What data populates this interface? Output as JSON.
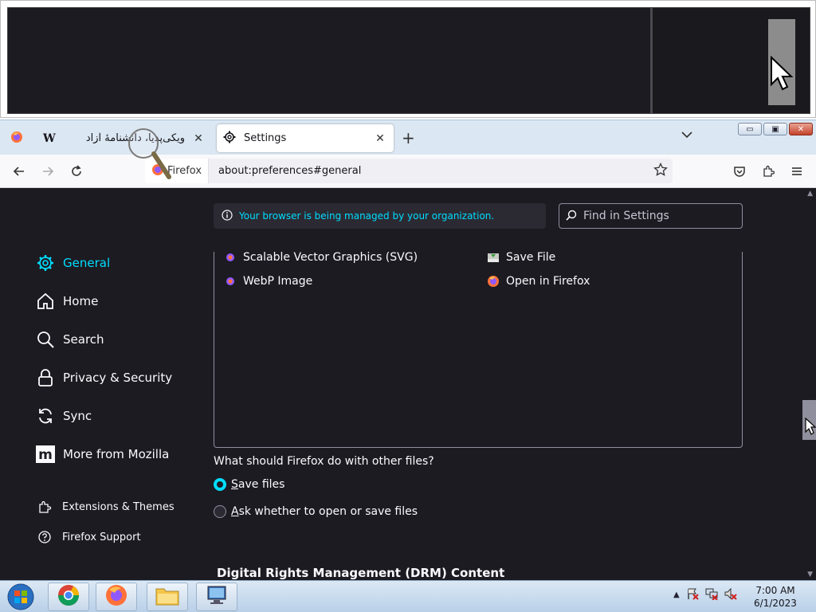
{
  "tabs": [
    {
      "label": "ویکی‌پدیا، دانشنامهٔ آزاد",
      "icon": "wikipedia-icon"
    },
    {
      "label": "Settings",
      "icon": "gear-icon",
      "active": true
    }
  ],
  "tabstrip": {
    "new_tab": "+",
    "list_all": "⌄"
  },
  "window_controls": {
    "minimize": "▭",
    "maximize": "▣",
    "close": "✕"
  },
  "navbar": {
    "identity_label": "Firefox",
    "url": "about:preferences#general"
  },
  "banner": {
    "message": "Your browser is being managed by your organization."
  },
  "search": {
    "placeholder": "Find in Settings"
  },
  "sidebar": {
    "items": [
      {
        "label": "General",
        "icon": "gear-icon",
        "active": true
      },
      {
        "label": "Home",
        "icon": "home-icon"
      },
      {
        "label": "Search",
        "icon": "search-icon"
      },
      {
        "label": "Privacy & Security",
        "icon": "lock-icon"
      },
      {
        "label": "Sync",
        "icon": "sync-icon"
      },
      {
        "label": "More from Mozilla",
        "icon": "mozilla-icon"
      }
    ],
    "footer": [
      {
        "label": "Extensions & Themes",
        "icon": "puzzle-icon"
      },
      {
        "label": "Firefox Support",
        "icon": "help-icon"
      }
    ]
  },
  "file_types": {
    "rows": [
      {
        "type": "Scalable Vector Graphics (SVG)",
        "action": "Save File",
        "action_icon": "save-icon"
      },
      {
        "type": "WebP Image",
        "action": "Open in Firefox",
        "action_icon": "firefox-icon"
      }
    ]
  },
  "other_files": {
    "question": "What should Firefox do with other files?",
    "options": [
      {
        "label_key": "S",
        "label_rest": "ave files",
        "checked": true
      },
      {
        "label_key": "A",
        "label_rest": "sk whether to open or save files",
        "checked": false
      }
    ]
  },
  "drm": {
    "heading": "Digital Rights Management (DRM) Content"
  },
  "taskbar": {
    "clock_time": "7:00 AM",
    "clock_date": "6/1/2023",
    "tray_up": "▲"
  },
  "colors": {
    "accent": "#00ddff",
    "content_bg": "#1c1b22",
    "panel_bg": "#2b2a33"
  }
}
